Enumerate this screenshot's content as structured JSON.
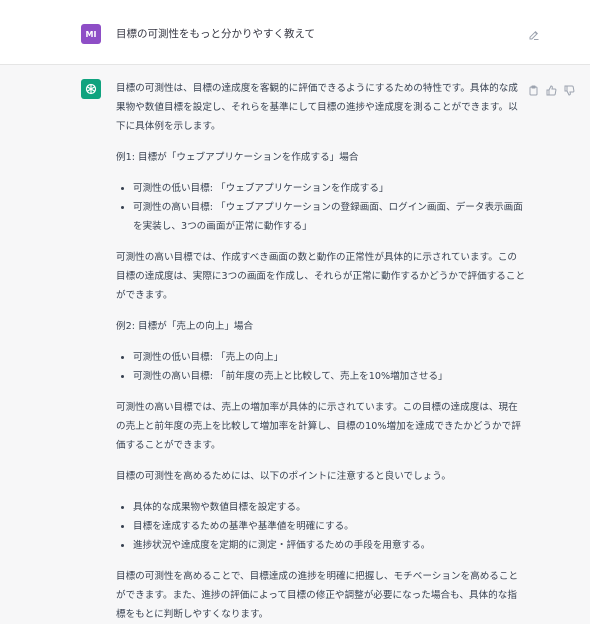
{
  "user": {
    "avatar": "MI",
    "message": "目標の可測性をもっと分かりやすく教えて"
  },
  "assistant": {
    "intro": "目標の可測性は、目標の達成度を客観的に評価できるようにするための特性です。具体的な成果物や数値目標を設定し、それらを基準にして目標の進捗や達成度を測ることができます。以下に具体例を示します。",
    "ex1_title": "例1: 目標が「ウェブアプリケーションを作成する」場合",
    "ex1_items": [
      "可測性の低い目標: 「ウェブアプリケーションを作成する」",
      "可測性の高い目標: 「ウェブアプリケーションの登録画面、ログイン画面、データ表示画面を実装し、3つの画面が正常に動作する」"
    ],
    "ex1_note": "可測性の高い目標では、作成すべき画面の数と動作の正常性が具体的に示されています。この目標の達成度は、実際に3つの画面を作成し、それらが正常に動作するかどうかで評価することができます。",
    "ex2_title": "例2: 目標が「売上の向上」場合",
    "ex2_items": [
      "可測性の低い目標: 「売上の向上」",
      "可測性の高い目標: 「前年度の売上と比較して、売上を10%増加させる」"
    ],
    "ex2_note": "可測性の高い目標では、売上の増加率が具体的に示されています。この目標の達成度は、現在の売上と前年度の売上を比較して増加率を計算し、目標の10%増加を達成できたかどうかで評価することができます。",
    "points_intro": "目標の可測性を高めるためには、以下のポイントに注意すると良いでしょう。",
    "points": [
      "具体的な成果物や数値目標を設定する。",
      "目標を達成するための基準や基準値を明確にする。",
      "進捗状況や達成度を定期的に測定・評価するための手段を用意する。"
    ],
    "conclusion": "目標の可測性を高めることで、目標達成の進捗を明確に把握し、モチベーションを高めることができます。また、進捗の評価によって目標の修正や調整が必要になった場合も、具体的な指標をもとに判断しやすくなります。"
  },
  "icons": {
    "edit": "edit-icon",
    "copy": "clipboard-icon",
    "like": "thumbs-up-icon",
    "dislike": "thumbs-down-icon",
    "bot": "openai-logo-icon"
  },
  "colors": {
    "user_avatar": "#8e4ec6",
    "bot_avatar": "#10a37f",
    "page_bg": "#f7f7f8"
  }
}
